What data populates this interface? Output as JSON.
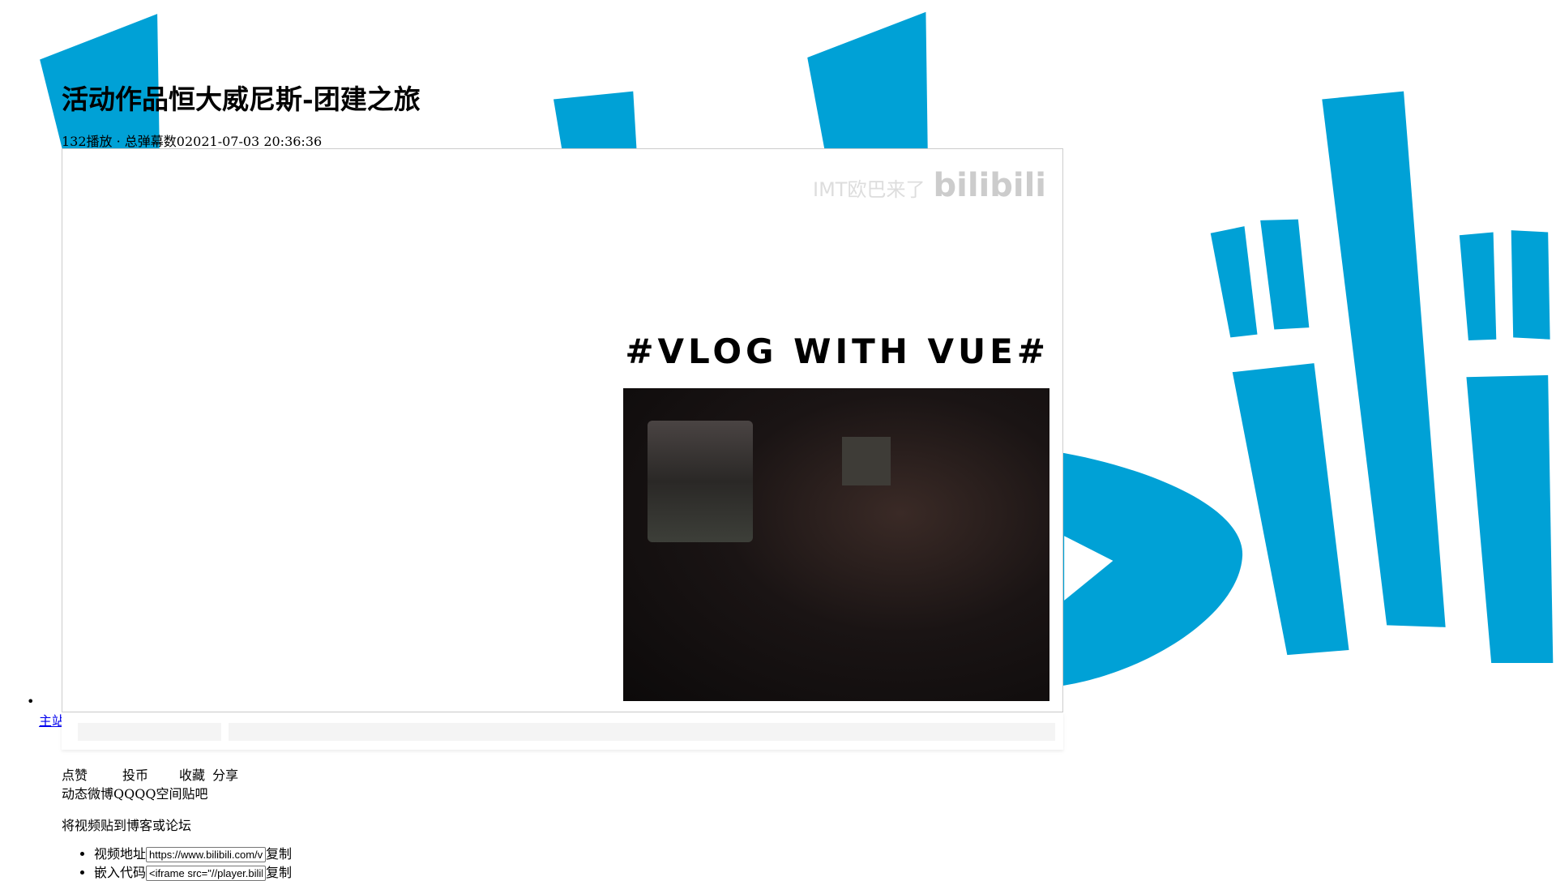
{
  "colors": {
    "brand": "#00a1d6"
  },
  "background": {
    "logo": "bilibili"
  },
  "video": {
    "title": "活动作品恒大威尼斯-团建之旅",
    "meta": "132播放 · 总弹幕数02021-07-03 20:36:36"
  },
  "player": {
    "watermark_text": "IMT欧巴来了",
    "watermark_logo": "bilibili",
    "overlay_text": "#VLOG WITH VUE#"
  },
  "nav": {
    "main_site": "主站"
  },
  "actions": {
    "like": "点赞",
    "coin": "投币",
    "favorite": "收藏",
    "share": "分享"
  },
  "share_targets": "动态微博QQQQ空间贴吧",
  "embed": {
    "title": "将视频贴到博客或论坛",
    "items": [
      {
        "label": "视频地址",
        "value": "https://www.bilibili.com/video/",
        "copy": "复制"
      },
      {
        "label": "嵌入代码",
        "value": "<iframe src=\"//player.bilibili.com/player.html\"></iframe>",
        "copy": "复制"
      }
    ]
  }
}
